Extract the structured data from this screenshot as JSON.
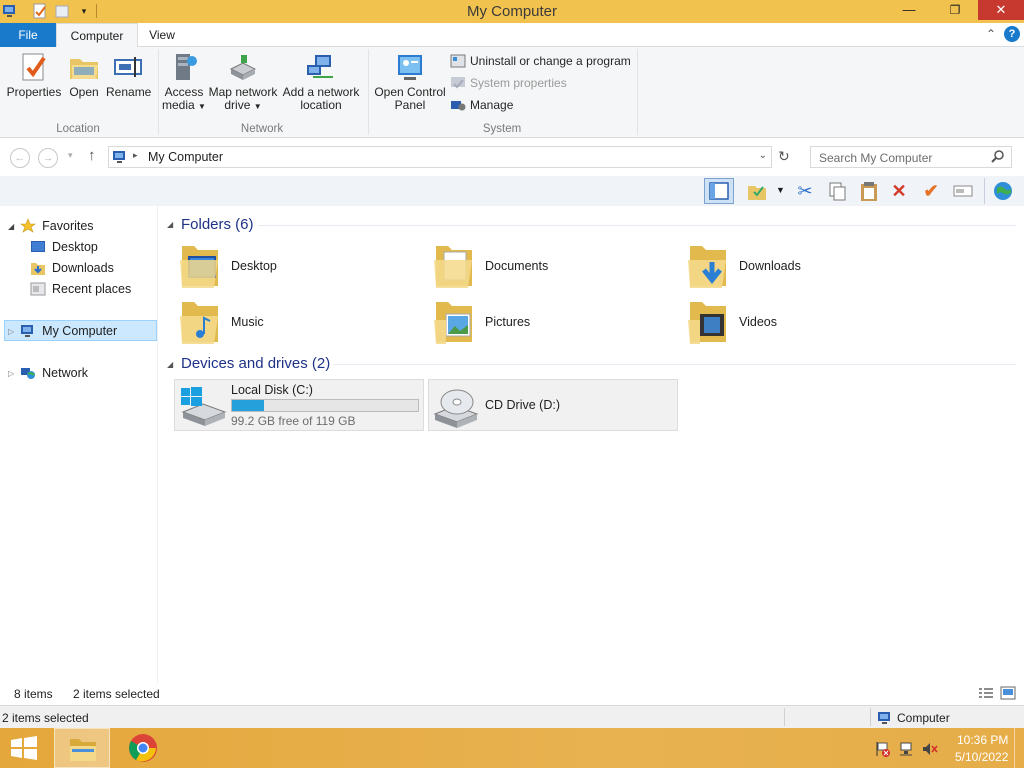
{
  "window": {
    "title": "My Computer"
  },
  "tabs": {
    "file": "File",
    "computer": "Computer",
    "view": "View"
  },
  "ribbon": {
    "location": {
      "properties": "Properties",
      "open": "Open",
      "rename": "Rename",
      "group": "Location"
    },
    "network": {
      "access_media_1": "Access",
      "access_media_2": "media",
      "map_drive_1": "Map network",
      "map_drive_2": "drive",
      "add_location_1": "Add a network",
      "add_location_2": "location",
      "group": "Network"
    },
    "system": {
      "control_panel_1": "Open Control",
      "control_panel_2": "Panel",
      "uninstall": "Uninstall or change a program",
      "system_properties": "System properties",
      "manage": "Manage",
      "group": "System"
    }
  },
  "address": {
    "path": "My Computer",
    "search_placeholder": "Search My Computer"
  },
  "nav_pane": {
    "favorites": "Favorites",
    "desktop": "Desktop",
    "downloads": "Downloads",
    "recent": "Recent places",
    "my_computer": "My Computer",
    "network": "Network"
  },
  "content": {
    "folders_header": "Folders (6)",
    "folders": [
      "Desktop",
      "Documents",
      "Downloads",
      "Music",
      "Pictures",
      "Videos"
    ],
    "devices_header": "Devices and drives (2)",
    "local_disk": {
      "name": "Local Disk (C:)",
      "free": "99.2 GB free of 119 GB",
      "used_fraction": 0.17
    },
    "cd_drive": {
      "name": "CD Drive (D:)"
    }
  },
  "status": {
    "items": "8 items",
    "selected": "2 items selected",
    "bottom_selected": "2 items selected",
    "zone": "Computer"
  },
  "taskbar": {
    "time": "10:36 PM",
    "date": "5/10/2022"
  },
  "colors": {
    "titlebar": "#f2c24e",
    "file_tab": "#1979ca",
    "close": "#c7392e",
    "header_text": "#1e3287",
    "progress": "#26a0da",
    "selection": "#cce8ff"
  }
}
